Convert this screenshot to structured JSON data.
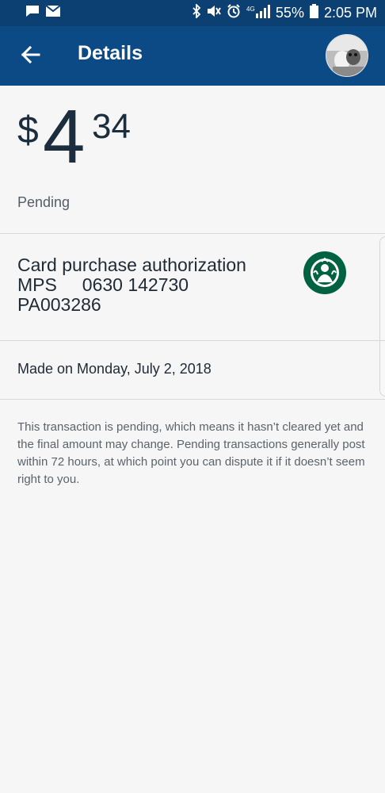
{
  "status_bar": {
    "battery": "55%",
    "time": "2:05 PM"
  },
  "header": {
    "title": "Details"
  },
  "transaction": {
    "currency_symbol": "$",
    "amount_whole": "4",
    "amount_cents": "34",
    "status": "Pending",
    "description_lines": [
      "Card purchase authorization",
      "MPS     0630 142730",
      "PA003286"
    ],
    "date_text": "Made on Monday, July 2, 2018",
    "note": "This transaction is pending, which means it hasn’t cleared yet and the final amount may change. Pending transactions generally post within 72 hours, at which point you can dispute it if it doesn’t seem right to you."
  },
  "icons": {
    "back": "arrow-left-icon",
    "merchant": "starbucks-logo-icon",
    "message": "chat-icon",
    "mail": "mail-icon",
    "bluetooth": "bluetooth-icon",
    "mute": "mute-icon",
    "alarm": "alarm-icon",
    "signal": "signal-icon",
    "battery": "battery-icon"
  },
  "colors": {
    "header": "#0c4a86",
    "statusbar": "#0c3f72",
    "background": "#f6f6f6",
    "text_dark": "#1f2a36",
    "text_muted": "#5b636b",
    "starbucks_green": "#006241"
  }
}
